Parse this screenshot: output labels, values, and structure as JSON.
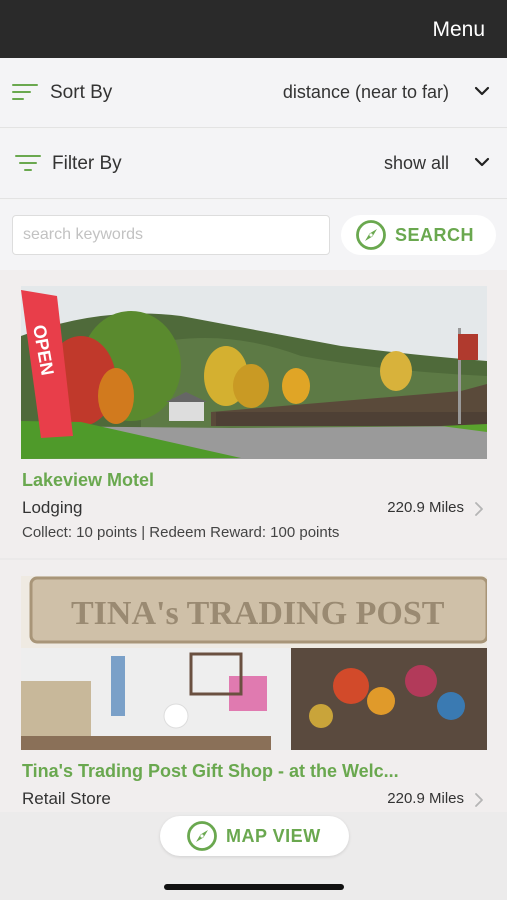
{
  "header": {
    "menu_label": "Menu"
  },
  "sort": {
    "label": "Sort By",
    "value": "distance (near to far)"
  },
  "filter": {
    "label": "Filter By",
    "value": "show all"
  },
  "search": {
    "placeholder": "search keywords",
    "button_label": "SEARCH"
  },
  "listings": [
    {
      "title": "Lakeview Motel",
      "category": "Lodging",
      "distance": "220.9 Miles",
      "points": "Collect: 10 points  |  Redeem Reward: 100 points",
      "sign_text": "OPEN"
    },
    {
      "title": "Tina's Trading Post Gift Shop - at the Welc...",
      "category": "Retail Store",
      "distance": "220.9 Miles",
      "sign_text": "TINA's TRADING POST"
    }
  ],
  "map": {
    "button_label": "MAP VIEW"
  },
  "colors": {
    "accent": "#6aa84f",
    "topbar": "#2a2a2a"
  }
}
